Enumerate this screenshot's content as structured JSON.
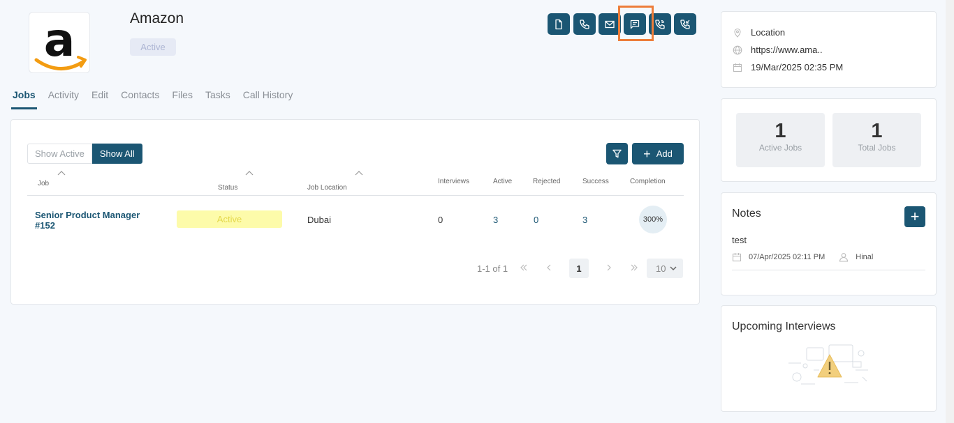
{
  "company": {
    "name": "Amazon",
    "status": "Active",
    "logo_icon": "amazon-logo"
  },
  "actions": [
    {
      "name": "document-icon"
    },
    {
      "name": "phone-icon"
    },
    {
      "name": "mail-icon"
    },
    {
      "name": "message-icon"
    },
    {
      "name": "phone-outgoing-icon"
    },
    {
      "name": "phone-incoming-icon"
    }
  ],
  "tabs": [
    "Jobs",
    "Activity",
    "Edit",
    "Contacts",
    "Files",
    "Tasks",
    "Call History"
  ],
  "jobs": {
    "toggle_off": "Show Active",
    "toggle_on": "Show All",
    "add_label": "Add",
    "columns": {
      "job": "Job",
      "status": "Status",
      "location": "Job Location",
      "interviews": "Interviews",
      "active": "Active",
      "rejected": "Rejected",
      "success": "Success",
      "completion": "Completion"
    },
    "rows": [
      {
        "job": "Senior Product Manager",
        "job_id": "#152",
        "status": "Active",
        "location": "Dubai",
        "interviews": "0",
        "active": "3",
        "rejected": "0",
        "success": "3",
        "completion": "300%"
      }
    ],
    "pager": {
      "range": "1-1 of 1",
      "page": "1",
      "per_page": "10"
    }
  },
  "info": {
    "location": "Location",
    "website": "https://www.ama..",
    "date": "19/Mar/2025 02:35 PM"
  },
  "stats": {
    "active_jobs": "1",
    "active_jobs_label": "Active Jobs",
    "total_jobs": "1",
    "total_jobs_label": "Total Jobs"
  },
  "notes": {
    "title": "Notes",
    "add_label": "+",
    "items": [
      {
        "text": "test",
        "date": "07/Apr/2025 02:11 PM",
        "author": "Hinal"
      }
    ]
  },
  "interviews": {
    "title": "Upcoming Interviews"
  },
  "colors": {
    "primary": "#1b5673",
    "highlight": "#ed7d3a",
    "status_active_bg": "#fdfbaa"
  }
}
